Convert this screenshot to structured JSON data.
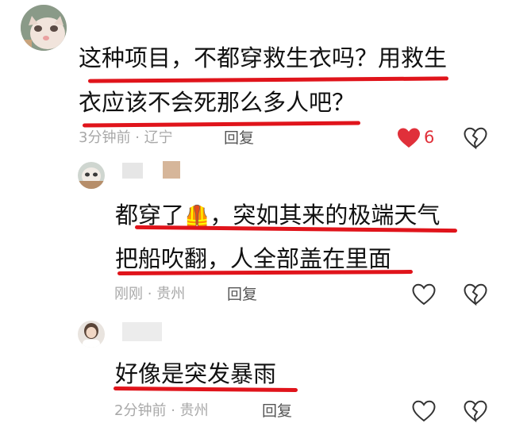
{
  "comments": [
    {
      "text_line1": "这种项目，不都穿救生衣吗？用救生",
      "text_line2": "衣应该不会死那么多人吧？",
      "time": "3分钟前",
      "location": "辽宁",
      "reply_label": "回复",
      "like_count": "6",
      "liked": true
    },
    {
      "text_line1_a": "都穿了",
      "vest_emoji": "🦺",
      "text_line1_b": "，突如其来的极端天气",
      "text_line2": "把船吹翻，人全部盖在里面",
      "time": "刚刚",
      "location": "贵州",
      "reply_label": "回复"
    },
    {
      "text_line1": "好像是突发暴雨",
      "time": "2分钟前",
      "location": "贵州",
      "reply_label": "回复"
    }
  ],
  "meta_separator": "·",
  "colors": {
    "underline": "#e0141b",
    "like_active": "#e0303a",
    "meta_gray": "#a8a8a8"
  },
  "icons": [
    "heart-icon",
    "broken-heart-icon"
  ]
}
